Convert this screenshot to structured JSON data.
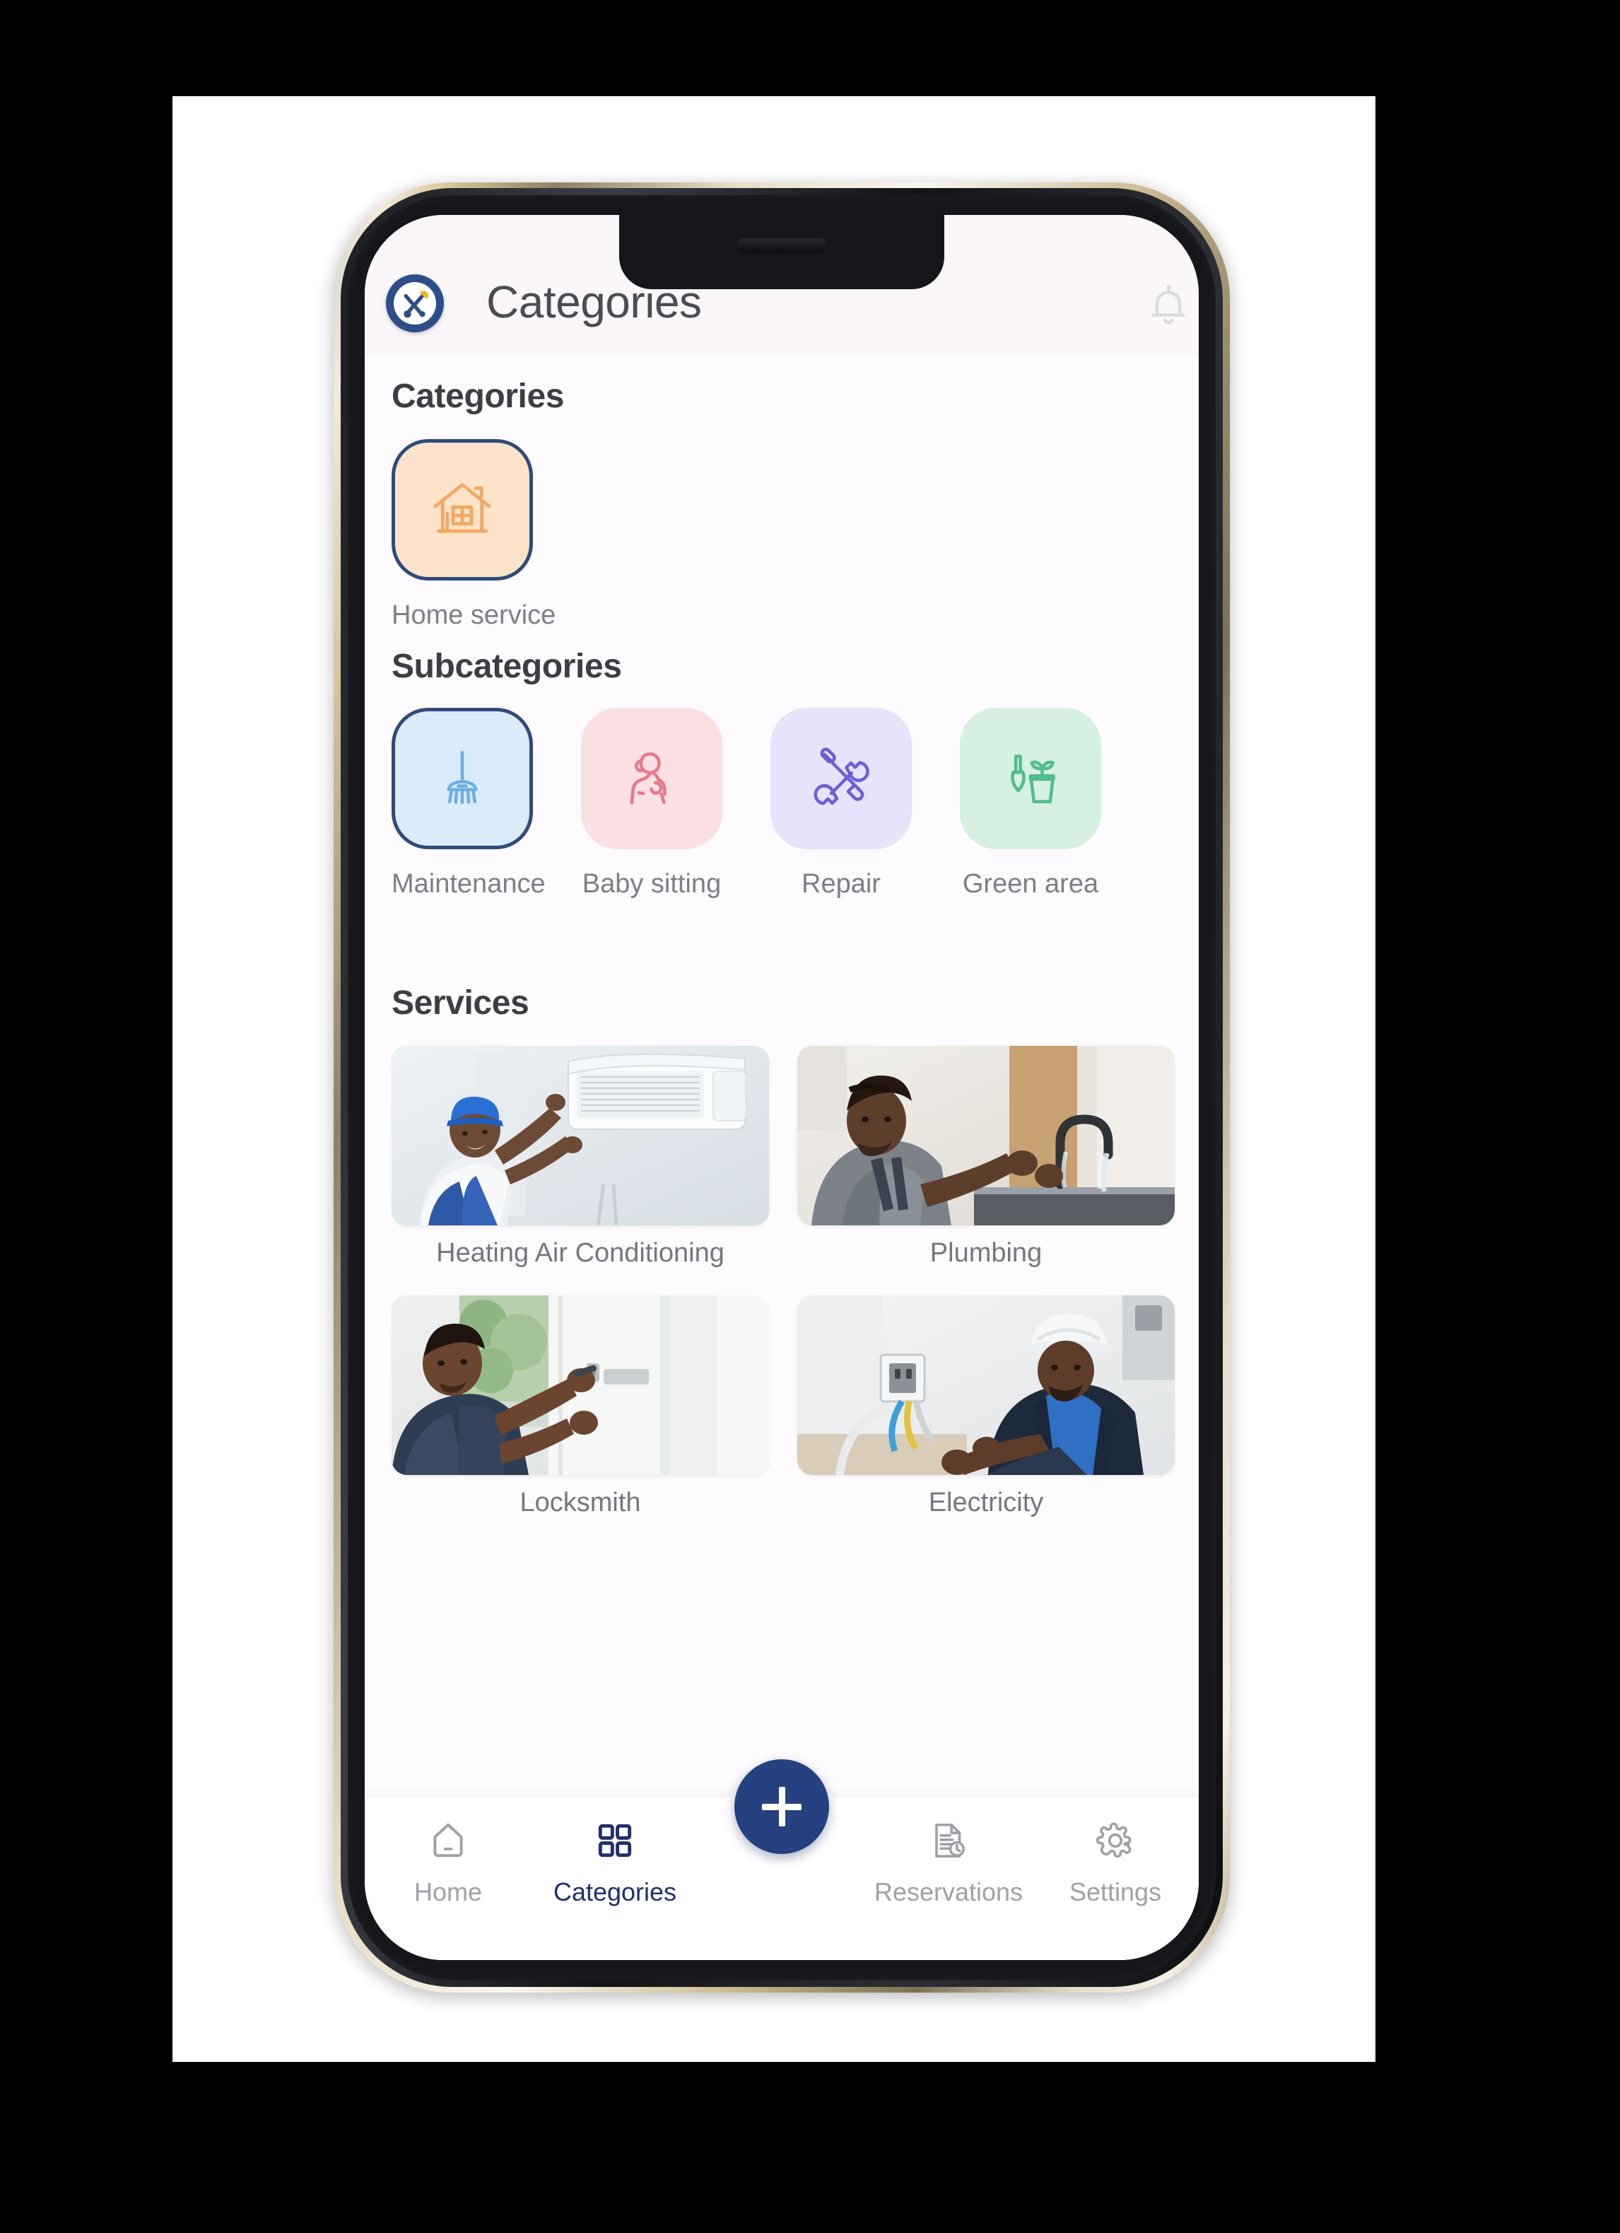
{
  "app": {
    "brand_icon": "crossed-tools-icon",
    "header_title": "Categories",
    "notification_icon": "bell-icon"
  },
  "sections": {
    "categories_heading": "Categories",
    "subcategories_heading": "Subcategories",
    "services_heading": "Services"
  },
  "categories": [
    {
      "label": "Home service",
      "icon": "house-icon",
      "bg": "#FCE3C9",
      "stroke": "#F3A962",
      "selected": true
    }
  ],
  "subcategories": [
    {
      "label": "Maintenance",
      "icon": "broom-icon",
      "bg": "#DCEBFA",
      "stroke": "#6EAEE4",
      "selected": true
    },
    {
      "label": "Baby sitting",
      "icon": "babysitter-icon",
      "bg": "#FBE0E3",
      "stroke": "#E8788A",
      "selected": false
    },
    {
      "label": "Repair",
      "icon": "wrench-screwdriver-icon",
      "bg": "#E6E3FB",
      "stroke": "#6C5FD6",
      "selected": false
    },
    {
      "label": "Green area",
      "icon": "potted-plant-trowel-icon",
      "bg": "#D6F0E2",
      "stroke": "#4FBE8B",
      "selected": false
    }
  ],
  "services": [
    {
      "label": "Heating Air Conditioning",
      "photo": "technician-servicing-ac-unit"
    },
    {
      "label": "Plumbing",
      "photo": "plumber-fixing-kitchen-faucet"
    },
    {
      "label": "Locksmith",
      "photo": "locksmith-installing-door-lock"
    },
    {
      "label": "Electricity",
      "photo": "electrician-wiring-outlet"
    }
  ],
  "fab": {
    "icon": "plus-icon",
    "color": "#254180"
  },
  "bottom_nav": {
    "items": [
      {
        "label": "Home",
        "icon": "home-icon",
        "active": false
      },
      {
        "label": "Categories",
        "icon": "grid-icon",
        "active": true
      },
      {
        "label": "Reservations",
        "icon": "document-clock-icon",
        "active": false
      },
      {
        "label": "Settings",
        "icon": "gear-icon",
        "active": false
      }
    ],
    "active_color": "#20306B",
    "inactive_color": "#A0A0A8"
  }
}
